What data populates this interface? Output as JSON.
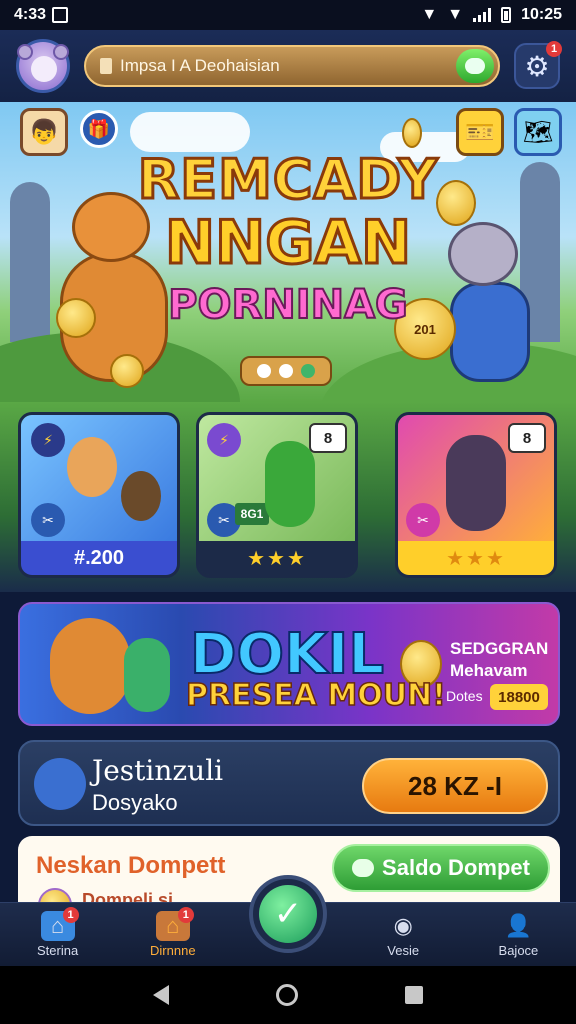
{
  "status_bar": {
    "left_time": "4:33",
    "right_time": "10:25"
  },
  "header": {
    "search_value": "Impsa I A Deohaisian",
    "settings_badge": "1"
  },
  "hero": {
    "title_line1": "REMCADY",
    "title_line2": "NNGAN",
    "title_line3": "PORNINAG",
    "coin_label": "201"
  },
  "cards": [
    {
      "footer": "#.200",
      "corner": ""
    },
    {
      "footer": "★★★",
      "corner": "8",
      "tag": "8G1"
    },
    {
      "footer": "★★★",
      "corner": "8"
    }
  ],
  "banner": {
    "title": "DOKIL",
    "subtitle": "PRESEA MOUN!",
    "side_title": "SEDGGRAN",
    "side_sub": "Mehavam",
    "side_label": "Dotes",
    "side_value": "18800"
  },
  "daily": {
    "title": "Jestinzuli",
    "subtitle": "Dosyako",
    "button": "28 KZ -I"
  },
  "wallet": {
    "title": "Neskan Dompett",
    "button": "Saldo Dompet",
    "sub": "Dompeli si"
  },
  "nav": {
    "items": [
      {
        "label": "Sterina",
        "badge": "1"
      },
      {
        "label": "Dirnnne",
        "badge": "1"
      },
      {
        "label": "Vesie",
        "badge": ""
      },
      {
        "label": "Bajoce",
        "badge": ""
      }
    ]
  },
  "colors": {
    "accent_orange": "#ffae3a",
    "accent_green": "#2e9d35",
    "nav_bg": "#1e2c4c"
  }
}
